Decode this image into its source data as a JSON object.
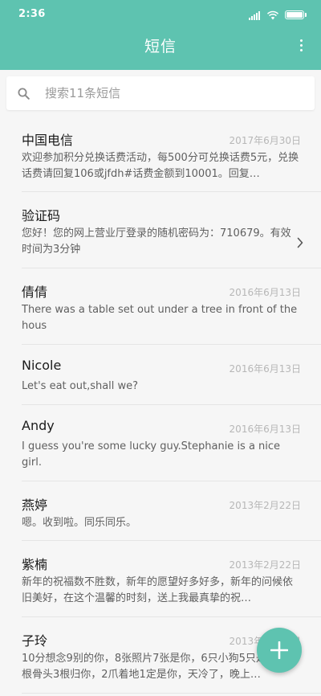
{
  "status_bar": {
    "time": "2:36",
    "battery_level": 1.0
  },
  "header": {
    "title": "短信"
  },
  "search": {
    "placeholder": "搜索11条短信"
  },
  "conversations": [
    {
      "name": "中国电信",
      "date": "2017年6月30日",
      "preview": "欢迎参加积分兑换话费活动，每500分可兑换话费5元，兑换话费请回复106或jfdh#话费金额到10001。回复…"
    },
    {
      "name": "验证码",
      "date": "",
      "preview": "您好！您的网上营业厅登录的随机密码为：710679。有效时间为3分钟"
    },
    {
      "name": "倩倩",
      "date": "2016年6月13日",
      "preview": "There was a table set out under a tree in front of the hous"
    },
    {
      "name": "Nicole",
      "date": "2016年6月13日",
      "preview": "Let's eat out,shall we?"
    },
    {
      "name": "Andy",
      "date": "2016年6月13日",
      "preview": "I guess you're some lucky guy.Stephanie is a nice girl."
    },
    {
      "name": "燕婷",
      "date": "2013年2月22日",
      "preview": "嗯。收到啦。同乐同乐。"
    },
    {
      "name": "紫楠",
      "date": "2013年2月22日",
      "preview": "新年的祝福数不胜数，新年的愿望好多好多，新年的问候依旧美好，在这个温馨的时刻，送上我最真挚的祝…"
    },
    {
      "name": "子玲",
      "date": "2013年2月22日",
      "preview": "10分想念9别的你，8张照片7张是你，6只小狗5只是你，4根骨头3根归你，2爪着地1定是你，天冷了，晚上…"
    }
  ],
  "colors": {
    "accent": "#5ec3b0",
    "background": "#f6f6f6"
  },
  "icons": {
    "search": "search-icon",
    "menu": "more-vertical-icon",
    "chevron": "chevron-right-icon",
    "fab": "plus-icon"
  }
}
